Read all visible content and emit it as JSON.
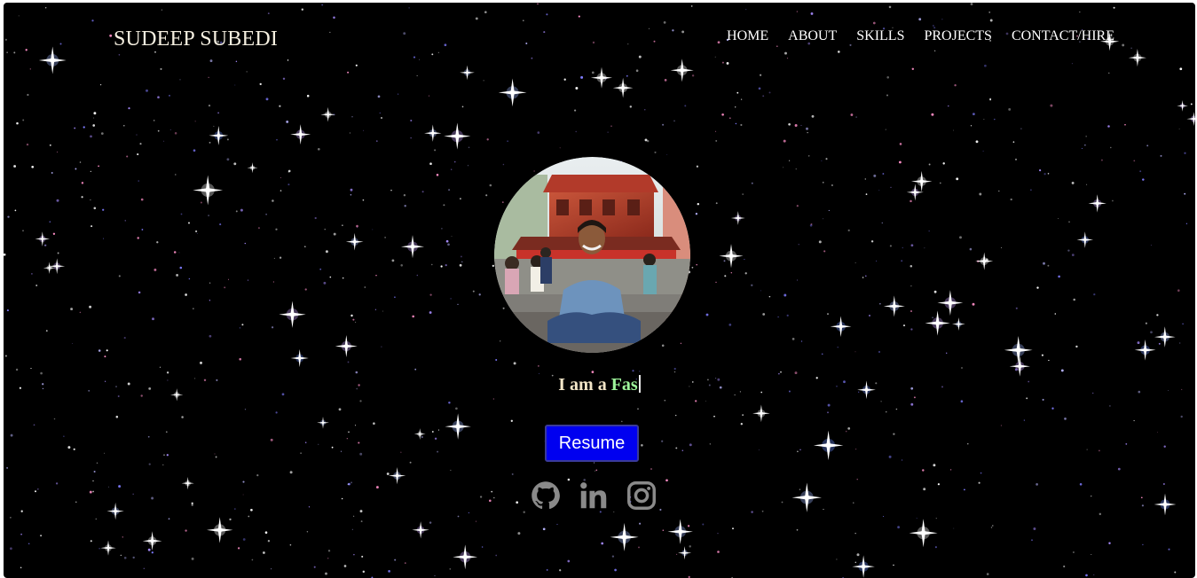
{
  "header": {
    "brand": "SUDEEP SUBEDI",
    "nav": [
      {
        "label": "HOME"
      },
      {
        "label": "ABOUT"
      },
      {
        "label": "SKILLS"
      },
      {
        "label": "PROJECTS"
      },
      {
        "label": "CONTACT/HIRE"
      }
    ]
  },
  "hero": {
    "typing_prefix": "I am a ",
    "typing_word": "Fas",
    "resume_label": "Resume",
    "socials": [
      {
        "icon": "github-icon"
      },
      {
        "icon": "linkedin-icon"
      },
      {
        "icon": "instagram-icon"
      }
    ]
  },
  "colors": {
    "background": "#000000",
    "brand_text": "#f5efe0",
    "typing_prefix": "#f3e6c8",
    "typing_word": "#9df59a",
    "resume_button": "#0000f0",
    "social_icon": "#8a8a8a"
  }
}
